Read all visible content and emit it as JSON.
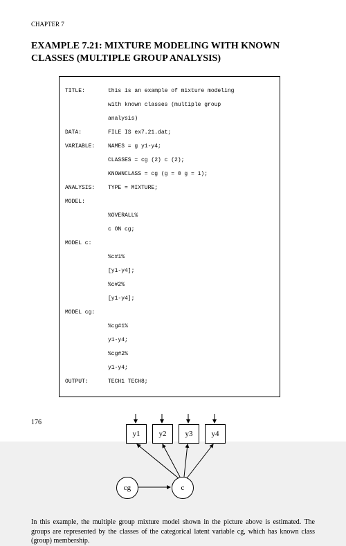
{
  "chapter_label": "CHAPTER 7",
  "title_line1": "EXAMPLE 7.21: MIXTURE MODELING WITH KNOWN",
  "title_line2": "CLASSES (MULTIPLE GROUP ANALYSIS)",
  "code": {
    "title_label": "TITLE:",
    "title_l1": "this is an example of mixture modeling",
    "title_l2": "with known classes (multiple group",
    "title_l3": "analysis)",
    "data_label": "DATA:",
    "data_l1": "FILE IS ex7.21.dat;",
    "variable_label": "VARIABLE:",
    "variable_l1": "NAMES = g y1-y4;",
    "variable_l2": "CLASSES = cg (2) c (2);",
    "variable_l3": "KNOWNCLASS = cg (g = 0 g = 1);",
    "analysis_label": "ANALYSIS:",
    "analysis_l1": "TYPE = MIXTURE;",
    "model_label": "MODEL:",
    "model_l1": "%OVERALL%",
    "model_l2": "c ON cg;",
    "modelc_label": "MODEL c:",
    "modelc_l1": "%c#1%",
    "modelc_l2": "[y1-y4];",
    "modelc_l3": "%c#2%",
    "modelc_l4": "[y1-y4];",
    "modelcg_label": "MODEL cg:",
    "modelcg_l1": "%cg#1%",
    "modelcg_l2": "y1-y4;",
    "modelcg_l3": "%cg#2%",
    "modelcg_l4": "y1-y4;",
    "output_label": "OUTPUT:",
    "output_l1": "TECH1 TECH8;"
  },
  "diagram": {
    "y1": "y1",
    "y2": "y2",
    "y3": "y3",
    "y4": "y4",
    "cg": "cg",
    "c": "c"
  },
  "paragraph": "In this example, the multiple group mixture model shown in the picture above is estimated.  The groups are represented by the classes of the categorical latent variable cg, which has known class (group) membership.",
  "page_number": "176"
}
